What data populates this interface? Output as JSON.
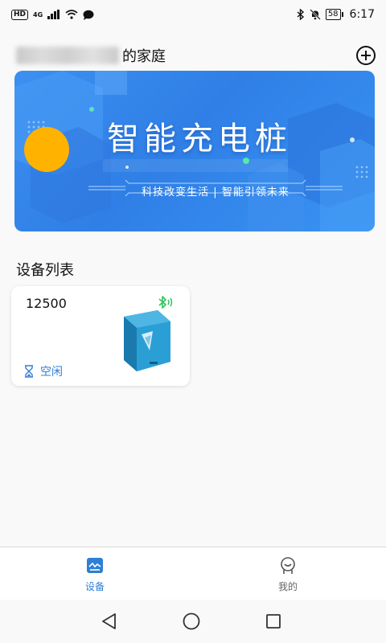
{
  "status_bar": {
    "hd": "HD",
    "network": "4G",
    "battery": "58",
    "time": "6:17"
  },
  "header": {
    "family_suffix": "的家庭",
    "add_icon": "plus-circle-icon"
  },
  "banner": {
    "title": "智能充电桩",
    "subtitle": "科技改变生活 | 智能引领未来"
  },
  "device_section": {
    "title": "设备列表",
    "devices": [
      {
        "name": "12500",
        "status": "空闲",
        "connection_icon": "bluetooth-icon",
        "status_icon": "hourglass-icon"
      }
    ]
  },
  "tab_bar": {
    "tabs": [
      {
        "label": "设备",
        "icon": "device-monitor-icon",
        "active": true
      },
      {
        "label": "我的",
        "icon": "profile-face-icon",
        "active": false
      }
    ]
  },
  "colors": {
    "accent": "#2f7fd6",
    "banner_blue": "#3a8cf0",
    "bluetooth_green": "#2ec45b",
    "sun_yellow": "#ffb300"
  }
}
